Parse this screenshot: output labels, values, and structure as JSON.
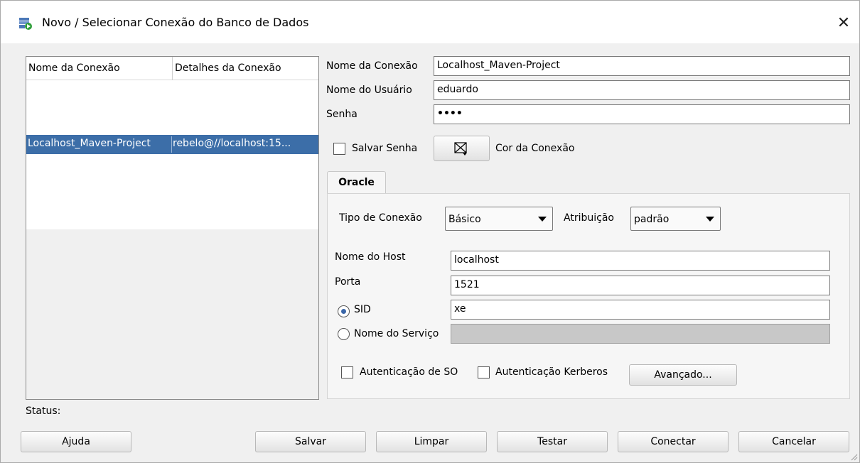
{
  "window": {
    "title": "Novo / Selecionar Conexão do Banco de Dados"
  },
  "connections": {
    "columns": [
      "Nome da Conexão",
      "Detalhes da Conexão"
    ],
    "rows": [
      {
        "name": "Localhost_Maven-Project",
        "details": "rebelo@//localhost:15..."
      }
    ]
  },
  "form": {
    "connection_name_label": "Nome da Conexão",
    "connection_name_value": "Localhost_Maven-Project",
    "username_label": "Nome do Usuário",
    "username_value": "eduardo",
    "password_label": "Senha",
    "password_mask": "••••",
    "save_password_label": "Salvar Senha",
    "connection_color_label": "Cor da Conexão"
  },
  "oracle_tab": {
    "tab_label": "Oracle",
    "connection_type_label": "Tipo de Conexão",
    "connection_type_value": "Básico",
    "role_label": "Atribuição",
    "role_value": "padrão",
    "host_label": "Nome do Host",
    "host_value": "localhost",
    "port_label": "Porta",
    "port_value": "1521",
    "sid_label": "SID",
    "sid_value": "xe",
    "service_label": "Nome do Serviço",
    "service_value": "",
    "os_auth_label": "Autenticação de SO",
    "kerberos_auth_label": "Autenticação Kerberos",
    "advanced_label": "Avançado..."
  },
  "status_label": "Status:",
  "buttons": {
    "help": "Ajuda",
    "save": "Salvar",
    "clear": "Limpar",
    "test": "Testar",
    "connect": "Conectar",
    "cancel": "Cancelar"
  }
}
